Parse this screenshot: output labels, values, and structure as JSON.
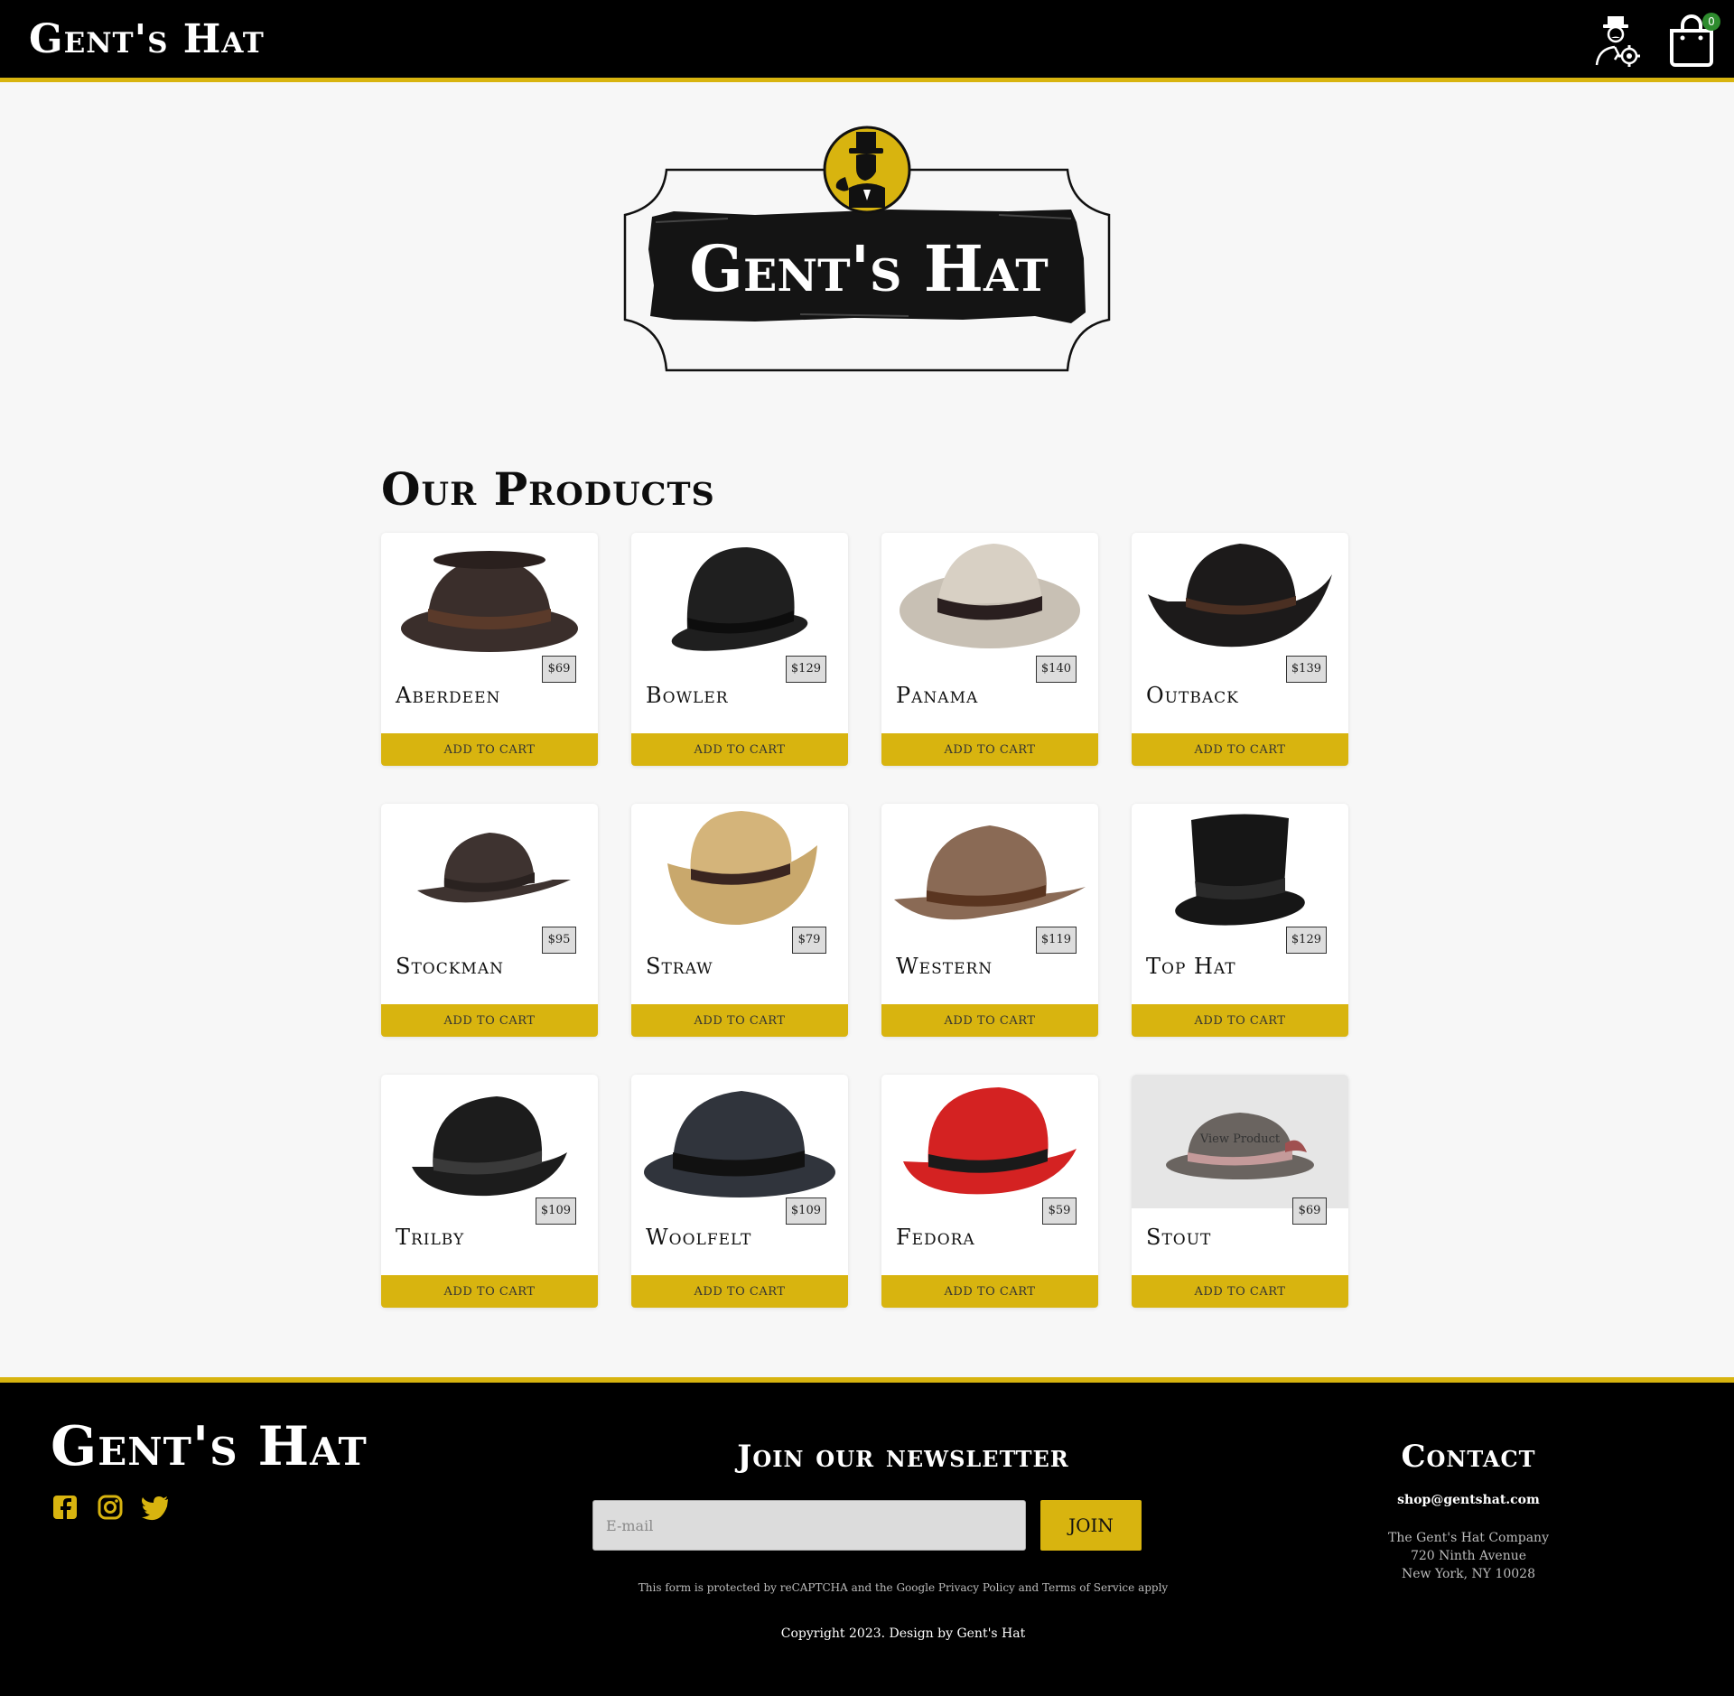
{
  "header": {
    "brand": "Gent's Hat",
    "account_icon": "user-gear-icon",
    "cart_icon": "shopping-bag-icon",
    "cart_count": "0"
  },
  "hero": {
    "logo_text": "Gent's Hat",
    "emblem_icon": "gentleman-top-hat-icon"
  },
  "products": {
    "title": "Our Products",
    "add_label": "ADD TO CART",
    "view_label": "View Product",
    "items": [
      {
        "name": "Aberdeen",
        "price": "$69",
        "hat": "porkpie",
        "color": "#3a2e2b",
        "band": "#5a3a2a"
      },
      {
        "name": "Bowler",
        "price": "$129",
        "hat": "bowler",
        "color": "#1f1f1f",
        "band": "#111111"
      },
      {
        "name": "Panama",
        "price": "$140",
        "hat": "panama",
        "color": "#c8c0b4",
        "band": "#2a1f1f"
      },
      {
        "name": "Outback",
        "price": "$139",
        "hat": "outback",
        "color": "#1c1a1a",
        "band": "#4a2f22"
      },
      {
        "name": "Stockman",
        "price": "$95",
        "hat": "stockman",
        "color": "#3e3330",
        "band": "#2a2220"
      },
      {
        "name": "Straw",
        "price": "$79",
        "hat": "straw",
        "color": "#c9a86c",
        "band": "#3a2520"
      },
      {
        "name": "Western",
        "price": "$119",
        "hat": "western",
        "color": "#8a6a55",
        "band": "#5a3520"
      },
      {
        "name": "Top Hat",
        "price": "$129",
        "hat": "tophat",
        "color": "#161616",
        "band": "#2a2a2a"
      },
      {
        "name": "Trilby",
        "price": "$109",
        "hat": "trilby",
        "color": "#1c1c1c",
        "band": "#3a3a3a"
      },
      {
        "name": "Woolfelt",
        "price": "$109",
        "hat": "woolfelt",
        "color": "#30343c",
        "band": "#111111"
      },
      {
        "name": "Fedora",
        "price": "$59",
        "hat": "fedora",
        "color": "#d42222",
        "band": "#1a1a1a"
      },
      {
        "name": "Stout",
        "price": "$69",
        "hat": "stout",
        "color": "#6a6460",
        "band": "#c49a9a"
      }
    ]
  },
  "footer": {
    "brand": "Gent's Hat",
    "social_icons": [
      "facebook-icon",
      "instagram-icon",
      "twitter-icon"
    ],
    "newsletter_title": "Join our newsletter",
    "email_placeholder": "E-mail",
    "join_label": "JOIN",
    "recaptcha_text": "This form is protected by reCAPTCHA and the Google Privacy Policy and Terms of Service apply",
    "copyright": "Copyright 2023. Design by Gent's Hat",
    "contact_title": "Contact",
    "contact_email": "shop@gentshat.com",
    "address": [
      "The Gent's Hat Company",
      "720 Ninth Avenue",
      "New York, NY 10028"
    ]
  },
  "colors": {
    "accent": "#d8b40f",
    "header_bg": "#000000",
    "page_bg": "#f7f7f7",
    "cart_badge": "#2e8b2e"
  }
}
